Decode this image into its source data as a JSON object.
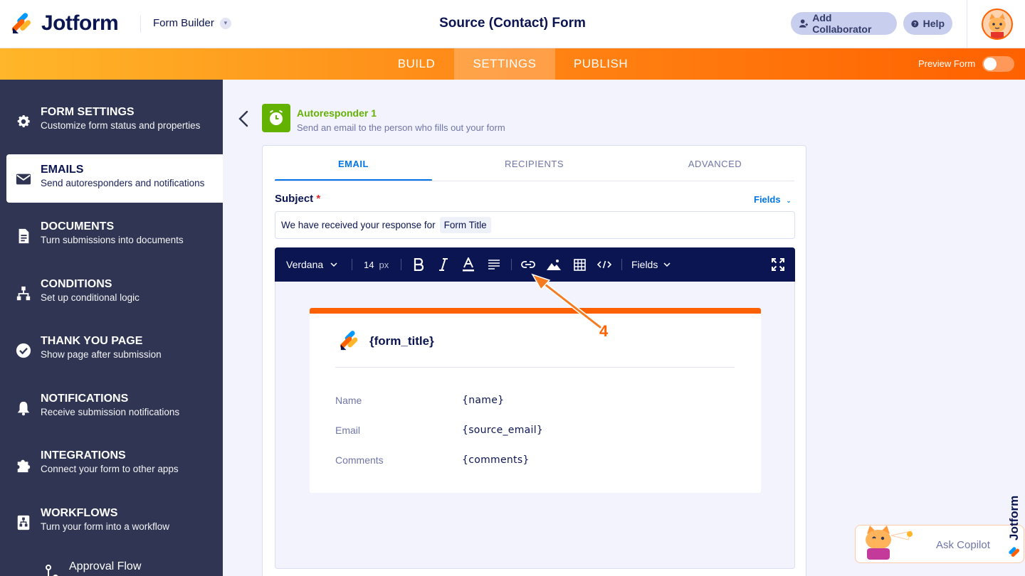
{
  "header": {
    "logo_text": "Jotform",
    "builder_menu": "Form Builder",
    "form_title": "Source (Contact) Form",
    "add_collaborator": "Add Collaborator",
    "help": "Help"
  },
  "nav": {
    "tabs": [
      {
        "label": "BUILD"
      },
      {
        "label": "SETTINGS",
        "active": true
      },
      {
        "label": "PUBLISH"
      }
    ],
    "preview_label": "Preview Form",
    "preview_on": false
  },
  "sidebar": {
    "items": [
      {
        "title": "FORM SETTINGS",
        "subtitle": "Customize form status and properties",
        "icon": "gear-icon"
      },
      {
        "title": "EMAILS",
        "subtitle": "Send autoresponders and notifications",
        "icon": "envelope-icon",
        "active": true
      },
      {
        "title": "DOCUMENTS",
        "subtitle": "Turn submissions into documents",
        "icon": "document-icon"
      },
      {
        "title": "CONDITIONS",
        "subtitle": "Set up conditional logic",
        "icon": "hierarchy-icon"
      },
      {
        "title": "THANK YOU PAGE",
        "subtitle": "Show page after submission",
        "icon": "check-circle-icon"
      },
      {
        "title": "NOTIFICATIONS",
        "subtitle": "Receive submission notifications",
        "icon": "bell-icon"
      },
      {
        "title": "INTEGRATIONS",
        "subtitle": "Connect your form to other apps",
        "icon": "puzzle-icon"
      },
      {
        "title": "WORKFLOWS",
        "subtitle": "Turn your form into a workflow",
        "icon": "workflow-icon"
      }
    ],
    "sub_item": "Approval Flow"
  },
  "autoresponder": {
    "title": "Autoresponder 1",
    "subtitle": "Send an email to the person who fills out your form"
  },
  "panel": {
    "tabs": [
      "EMAIL",
      "RECIPIENTS",
      "ADVANCED"
    ],
    "subject_label": "Subject",
    "required_mark": "*",
    "fields_link": "Fields",
    "subject_text": "We have received your response for",
    "subject_tag": "Form Title",
    "toolbar": {
      "font": "Verdana",
      "size": "14",
      "size_unit": "px",
      "fields": "Fields"
    },
    "email": {
      "title": "{form_title}",
      "rows": [
        {
          "label": "Name",
          "value": "{name}"
        },
        {
          "label": "Email",
          "value": "{source_email}"
        },
        {
          "label": "Comments",
          "value": "{comments}"
        }
      ]
    }
  },
  "annotation": {
    "step": "4"
  },
  "copilot": {
    "label": "Ask Copilot"
  },
  "brand_vertical": "Jotform",
  "colors": {
    "accent_orange": "#ff6100",
    "sidebar_bg": "#2f3552",
    "navy": "#0a1551",
    "link_blue": "#0075e3",
    "green": "#64b200"
  }
}
